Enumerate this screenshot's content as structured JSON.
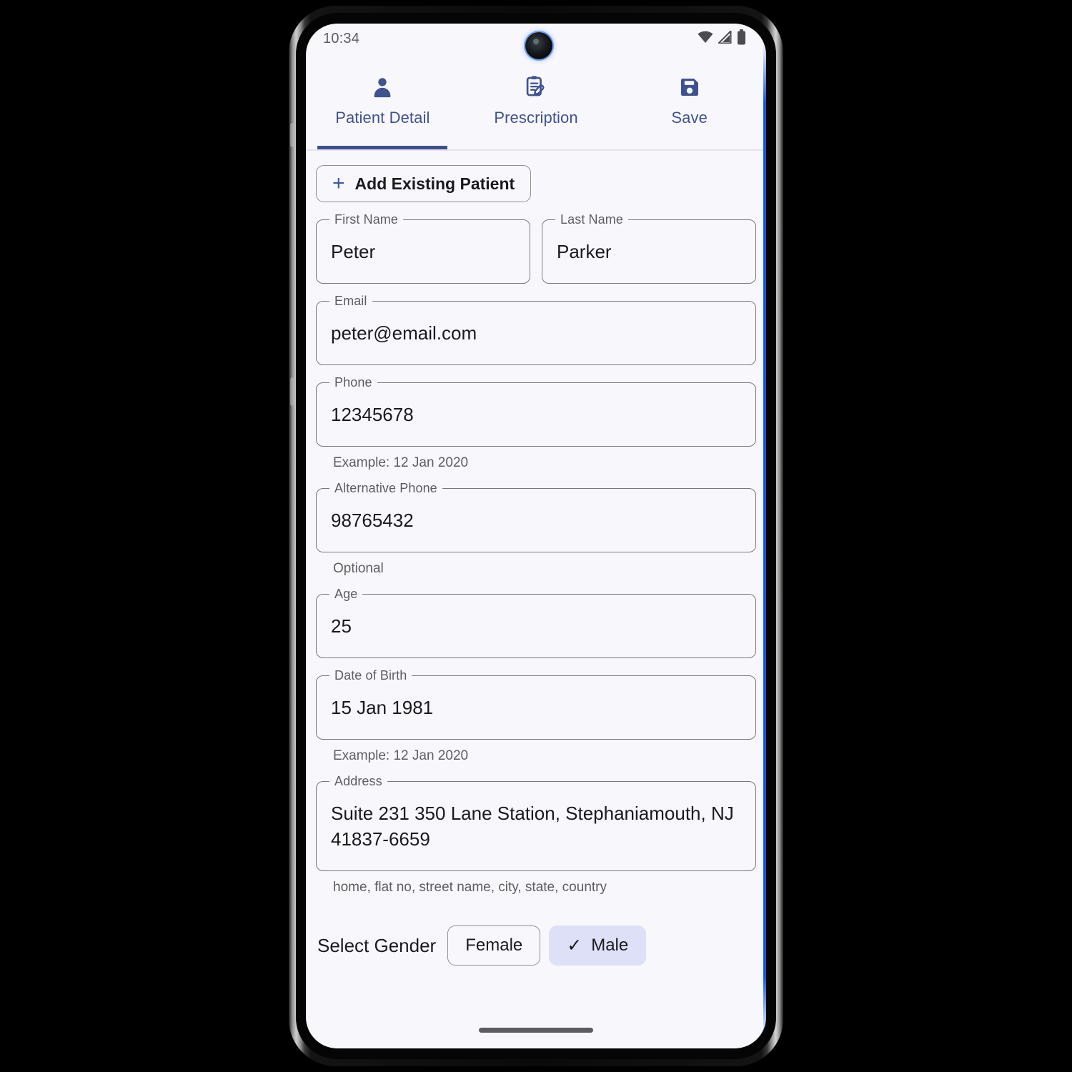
{
  "status_bar": {
    "time": "10:34",
    "icons": [
      "wifi-icon",
      "cellular-signal-icon",
      "battery-icon"
    ]
  },
  "tabs": [
    {
      "label": "Patient Detail",
      "icon": "person-icon",
      "active": true
    },
    {
      "label": "Prescription",
      "icon": "clipboard-edit-icon",
      "active": false
    },
    {
      "label": "Save",
      "icon": "floppy-disk-save-icon",
      "active": false
    }
  ],
  "toolbar": {
    "add_existing_patient_label": "Add Existing Patient",
    "add_icon": "plus-icon"
  },
  "form": {
    "first_name": {
      "label": "First Name",
      "value": "Peter",
      "helper": ""
    },
    "last_name": {
      "label": "Last Name",
      "value": "Parker",
      "helper": ""
    },
    "email": {
      "label": "Email",
      "value": "peter@email.com",
      "helper": ""
    },
    "phone": {
      "label": "Phone",
      "value": "12345678",
      "helper": "Example: 12 Jan 2020"
    },
    "alt_phone": {
      "label": "Alternative Phone",
      "value": "98765432",
      "helper": "Optional"
    },
    "age": {
      "label": "Age",
      "value": "25",
      "helper": ""
    },
    "dob": {
      "label": "Date of Birth",
      "value": "15 Jan 1981",
      "helper": "Example: 12 Jan 2020"
    },
    "address": {
      "label": "Address",
      "value": "Suite 231 350 Lane Station, Stephaniamouth, NJ 41837-6659",
      "helper": "home, flat no, street name, city, state, country"
    }
  },
  "gender": {
    "label": "Select Gender",
    "options": [
      {
        "label": "Female",
        "selected": false
      },
      {
        "label": "Male",
        "selected": true
      }
    ],
    "check_icon": "check-icon"
  },
  "colors": {
    "accent": "#3d4f8c",
    "tab_label": "#3f5290",
    "chip_selected_bg": "#dee0f7",
    "screen_bg": "#f8f8fc",
    "field_border": "#77777f",
    "helper_text": "#5c5c63"
  }
}
